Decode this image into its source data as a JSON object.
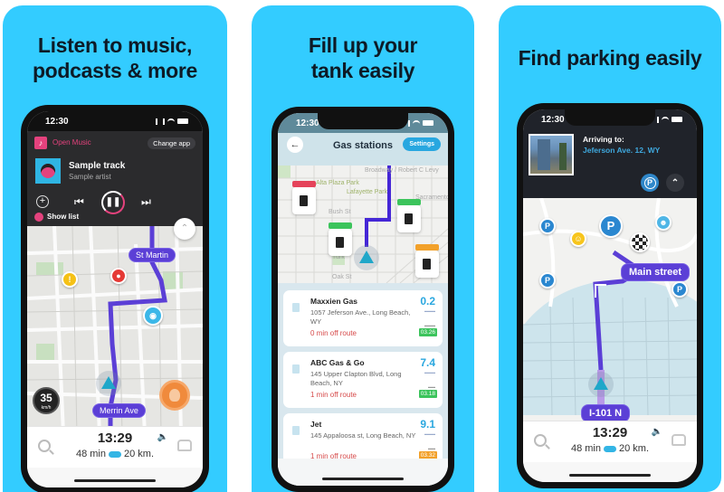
{
  "panels": [
    {
      "headline": [
        "Listen to music,",
        "podcasts & more"
      ],
      "status_time": "12:30",
      "music": {
        "app_name": "Open Music",
        "change_app": "Change app",
        "track": "Sample track",
        "artist": "Sample artist",
        "show_list": "Show list",
        "icons": [
          "music-app-icon",
          "add-icon",
          "previous-icon",
          "pause-icon",
          "next-icon"
        ]
      },
      "map_labels": [
        "St Martin",
        "Merrin Ave"
      ],
      "speed": {
        "value": "35",
        "unit": "km/h"
      },
      "nav": {
        "eta": "13:29",
        "duration": "48 min",
        "distance": "20 km."
      }
    },
    {
      "headline": [
        "Fill up your",
        "tank easily"
      ],
      "status_time": "12:30",
      "header": {
        "title": "Gas stations",
        "settings": "Settings"
      },
      "map_labels": [
        "Alta Plaza Park",
        "Lafayette Park",
        "Bush St",
        "Turk",
        "Oak St",
        "Broadway / Robert C Levy",
        "Sacramento"
      ],
      "stations": [
        {
          "name": "Maxxien Gas",
          "address": "1057 Jeferson Ave., Long Beach, WY",
          "off_route": "0 min off route",
          "distance": "0.2",
          "price": "03.26",
          "price_color": "#3cc45c"
        },
        {
          "name": "ABC Gas & Go",
          "address": "145 Upper Clapton Blvd, Long Beach, NY",
          "off_route": "1 min off route",
          "distance": "7.4",
          "price": "03.18",
          "price_color": "#3cc45c"
        },
        {
          "name": "Jet",
          "address": "145 Appaloosa st, Long Beach, NY",
          "off_route": "1 min off route",
          "distance": "9.1",
          "price": "03.32",
          "price_color": "#f2a12a"
        }
      ],
      "map_pins": [
        {
          "tag_color": "#e5435a"
        },
        {
          "tag_color": "#3cc45c"
        },
        {
          "tag_color": "#3cc45c"
        },
        {
          "tag_color": "#f2a12a"
        }
      ]
    },
    {
      "headline": [
        "Find parking easily"
      ],
      "status_time": "12:30",
      "arrive": {
        "label": "Arriving to:",
        "address": "Jeferson Ave. 12, WY",
        "parking_button": "P"
      },
      "map_labels": [
        "Main street",
        "I-101 N"
      ],
      "parking_marker": "P",
      "nav": {
        "eta": "13:29",
        "duration": "48 min",
        "distance": "20 km."
      }
    }
  ],
  "colors": {
    "background": "#33ccff",
    "route": "#5b3fd6",
    "music_accent": "#e4427d",
    "distance_blue": "#2aa7df"
  }
}
